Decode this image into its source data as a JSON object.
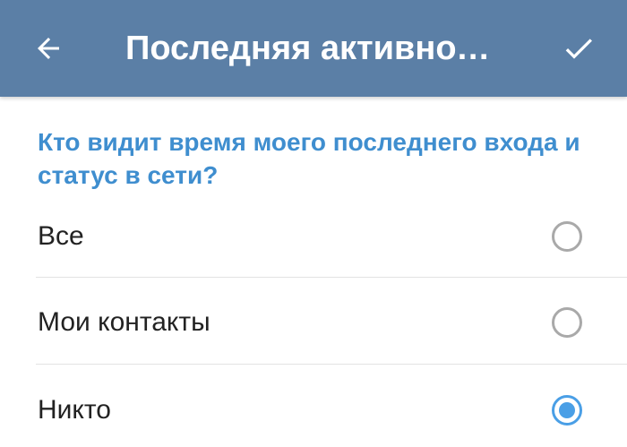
{
  "toolbar": {
    "title": "Последняя активнос...",
    "back_icon": "arrow-left-icon",
    "done_icon": "checkmark-icon",
    "background_color": "#5b7fa6"
  },
  "section": {
    "header": "Кто видит время моего последнего входа и статус в сети?",
    "header_color": "#3f8ecf"
  },
  "options": [
    {
      "label": "Все",
      "selected": false
    },
    {
      "label": "Мои контакты",
      "selected": false
    },
    {
      "label": "Никто",
      "selected": true
    }
  ],
  "accent_color": "#4a9fe6"
}
